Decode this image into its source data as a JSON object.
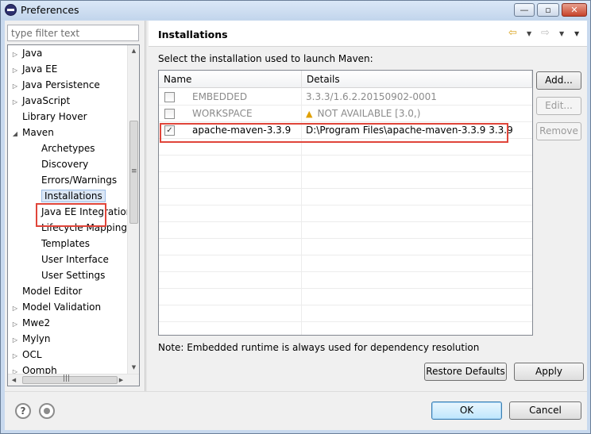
{
  "window": {
    "title": "Preferences"
  },
  "filter": {
    "placeholder": "type filter text"
  },
  "tree": {
    "items": [
      {
        "label": "Java",
        "level": 0,
        "twisty": "collapsed"
      },
      {
        "label": "Java EE",
        "level": 0,
        "twisty": "collapsed"
      },
      {
        "label": "Java Persistence",
        "level": 0,
        "twisty": "collapsed"
      },
      {
        "label": "JavaScript",
        "level": 0,
        "twisty": "collapsed"
      },
      {
        "label": "Library Hover",
        "level": 0,
        "twisty": "none"
      },
      {
        "label": "Maven",
        "level": 0,
        "twisty": "expanded"
      },
      {
        "label": "Archetypes",
        "level": 1,
        "twisty": "none"
      },
      {
        "label": "Discovery",
        "level": 1,
        "twisty": "none"
      },
      {
        "label": "Errors/Warnings",
        "level": 1,
        "twisty": "none"
      },
      {
        "label": "Installations",
        "level": 1,
        "twisty": "none",
        "selected": true
      },
      {
        "label": "Java EE Integration",
        "level": 1,
        "twisty": "none"
      },
      {
        "label": "Lifecycle Mappings",
        "level": 1,
        "twisty": "none"
      },
      {
        "label": "Templates",
        "level": 1,
        "twisty": "none"
      },
      {
        "label": "User Interface",
        "level": 1,
        "twisty": "none"
      },
      {
        "label": "User Settings",
        "level": 1,
        "twisty": "none"
      },
      {
        "label": "Model Editor",
        "level": 0,
        "twisty": "none"
      },
      {
        "label": "Model Validation",
        "level": 0,
        "twisty": "collapsed"
      },
      {
        "label": "Mwe2",
        "level": 0,
        "twisty": "collapsed"
      },
      {
        "label": "Mylyn",
        "level": 0,
        "twisty": "collapsed"
      },
      {
        "label": "OCL",
        "level": 0,
        "twisty": "collapsed"
      },
      {
        "label": "Oomph",
        "level": 0,
        "twisty": "collapsed"
      }
    ]
  },
  "page": {
    "title": "Installations",
    "instruction": "Select the installation used to launch Maven:",
    "columns": {
      "name": "Name",
      "details": "Details"
    },
    "rows": [
      {
        "checked": false,
        "name": "EMBEDDED",
        "details": "3.3.3/1.6.2.20150902-0001",
        "dim": true,
        "warning": false
      },
      {
        "checked": false,
        "name": "WORKSPACE",
        "details": "NOT AVAILABLE [3.0,)",
        "dim": true,
        "warning": true
      },
      {
        "checked": true,
        "name": "apache-maven-3.3.9",
        "details": "D:\\Program Files\\apache-maven-3.3.9 3.3.9",
        "dim": false,
        "warning": false
      }
    ],
    "buttons": {
      "add": "Add...",
      "edit": "Edit...",
      "remove": "Remove"
    },
    "note": "Note: Embedded runtime is always used for dependency resolution",
    "restore_defaults": "Restore Defaults",
    "apply": "Apply"
  },
  "dialog": {
    "ok": "OK",
    "cancel": "Cancel"
  },
  "icons": {
    "back": "arrow-left-icon",
    "forward": "arrow-right-icon",
    "help": "help-icon",
    "record": "record-icon",
    "warning": "warning-icon"
  },
  "colors": {
    "highlight_box": "#e0453a",
    "selection": "#dbe7f6"
  }
}
